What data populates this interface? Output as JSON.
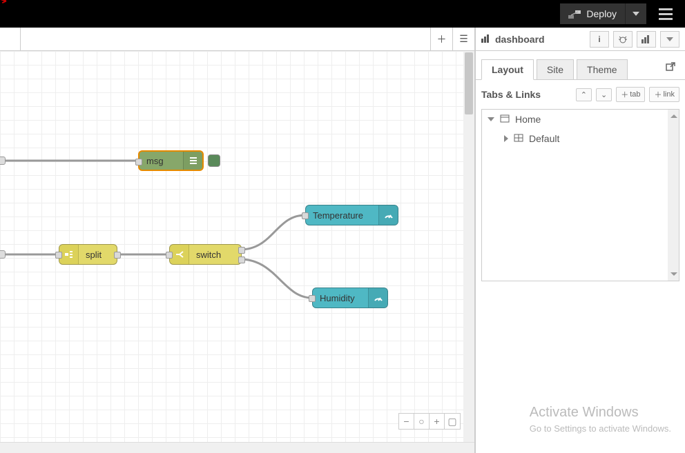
{
  "topbar": {
    "deploy_label": "Deploy"
  },
  "sidebar": {
    "title": "dashboard",
    "tabs": {
      "layout": "Layout",
      "site": "Site",
      "theme": "Theme"
    },
    "tabs_links_label": "Tabs & Links",
    "add_tab_label": "tab",
    "add_link_label": "link",
    "tree": {
      "home": "Home",
      "default": "Default"
    }
  },
  "nodes": {
    "debug": "msg",
    "split": "split",
    "switch": "switch",
    "temperature": "Temperature",
    "humidity": "Humidity"
  },
  "footer": {
    "minus": "−",
    "reset": "○",
    "plus": "+",
    "map": "▢"
  },
  "watermark": {
    "line1": "Activate Windows",
    "line2": "Go to Settings to activate Windows."
  }
}
